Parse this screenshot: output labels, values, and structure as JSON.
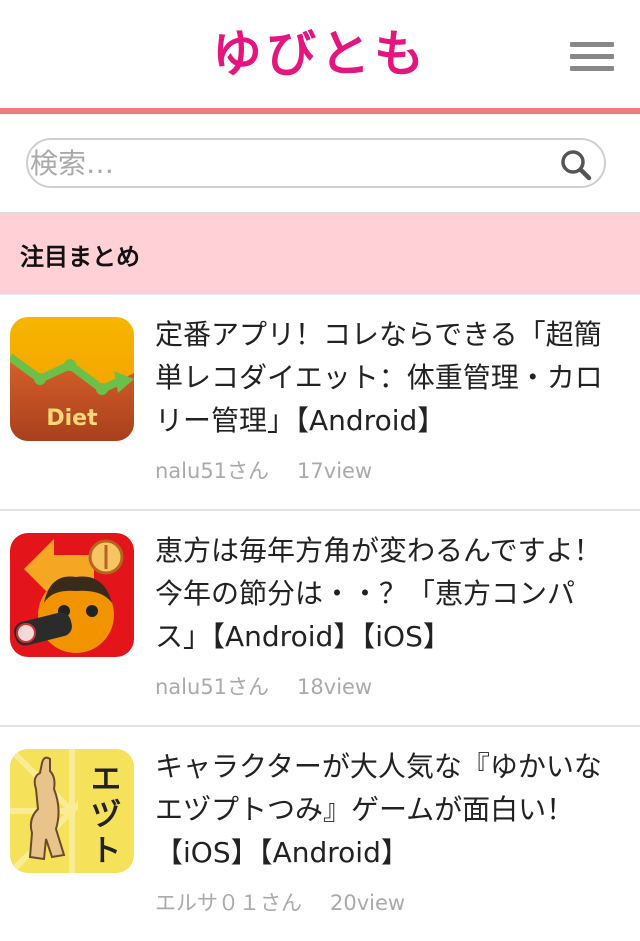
{
  "header": {
    "logo": "ゆびとも",
    "menu_icon": "hamburger-menu-icon"
  },
  "search": {
    "placeholder": "検索…",
    "icon": "search-icon"
  },
  "section": {
    "title": "注目まとめ"
  },
  "items": [
    {
      "title": "定番アプリ！コレならできる「超簡単レコダイエット：体重管理・カロリー管理」【Android】",
      "author": "nalu51さん",
      "views": "17view",
      "thumb_label": "Diet",
      "icon": "diet-app-icon"
    },
    {
      "title": "恵方は毎年方角が変わるんですよ！今年の節分は・・？「恵方コンパス」【Android】【iOS】",
      "author": "nalu51さん",
      "views": "18view",
      "icon": "ehou-compass-app-icon"
    },
    {
      "title": "キャラクターが大人気な『ゆかいな エヅプトつみ』ゲームが面白い！【iOS】【Android】",
      "author": "エルサ０１さん",
      "views": "20view",
      "thumb_label": "エヅプトつみ",
      "icon": "egypt-tsumi-app-icon"
    }
  ],
  "colors": {
    "brand": "#e5157f",
    "accent_line": "#f17a7a",
    "section_bg": "#ffd1d6"
  }
}
